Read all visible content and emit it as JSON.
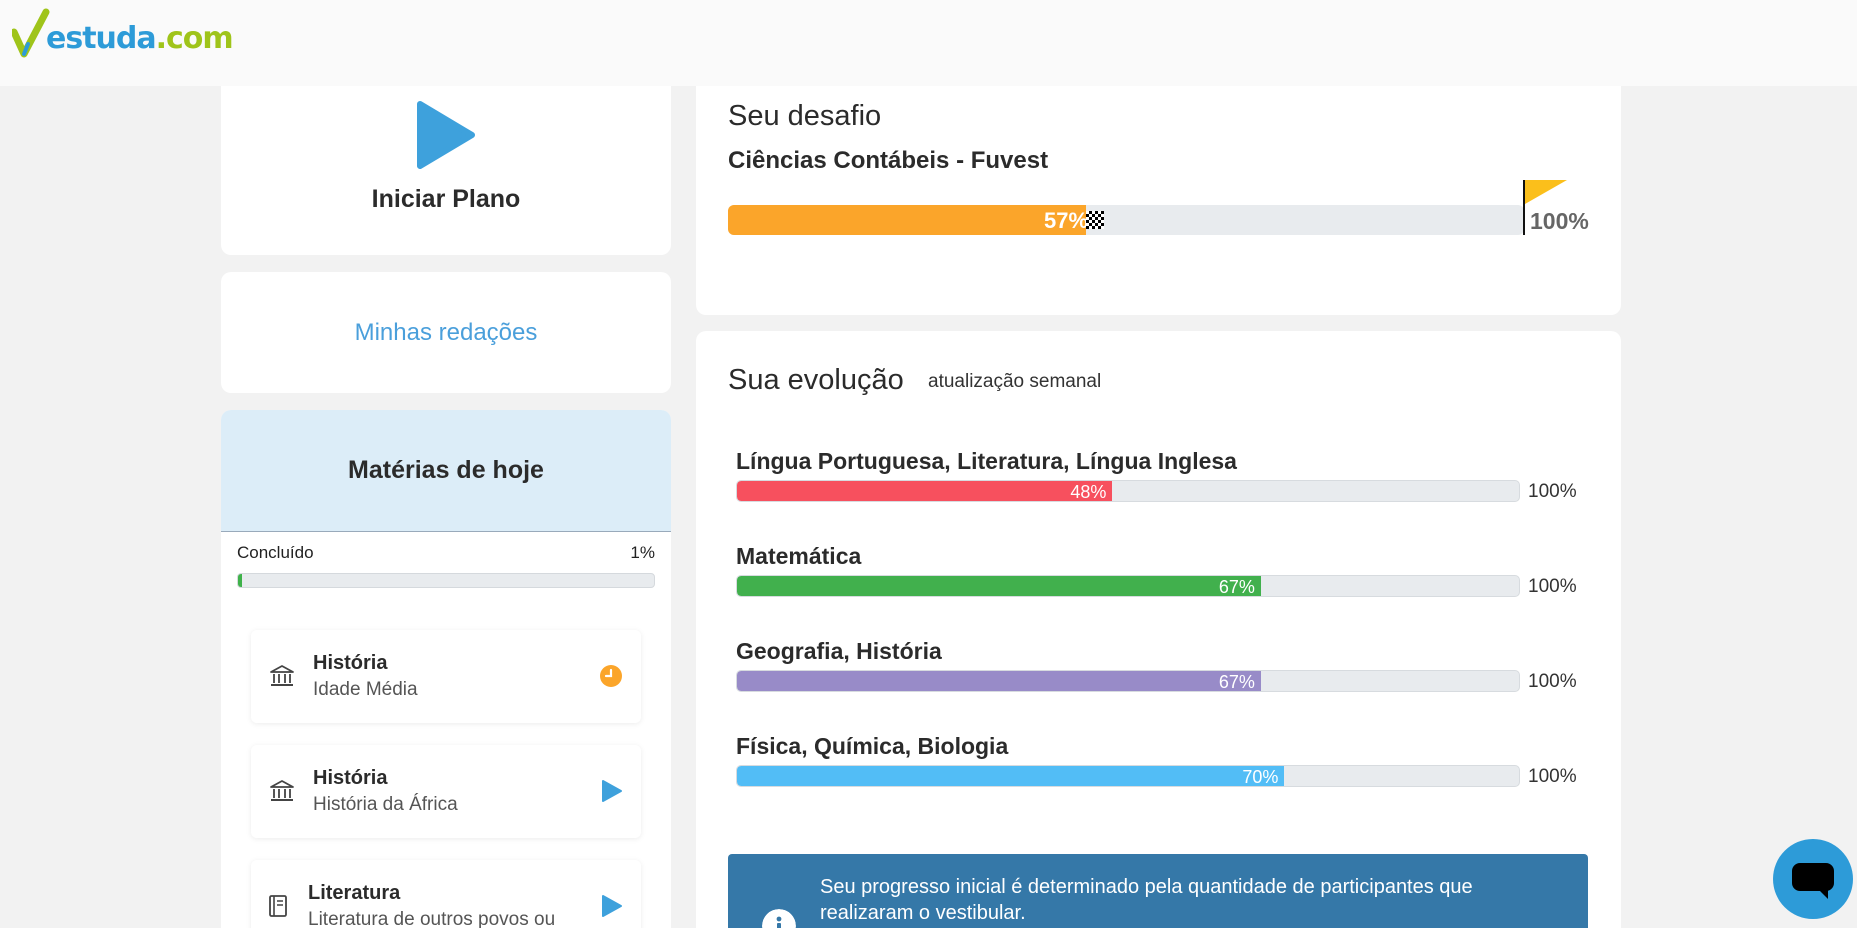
{
  "brand": {
    "logo_part1": "estuda",
    "logo_part2": ".com"
  },
  "plan": {
    "label": "Iniciar Plano"
  },
  "redacoes": {
    "label": "Minhas redações"
  },
  "materias": {
    "title": "Matérias de hoje",
    "concluido_label": "Concluído",
    "concluido_value": "1%",
    "concluido_fraction": 0.01,
    "items": [
      {
        "title": "História",
        "subtitle": "Idade Média",
        "icon": "museum-icon",
        "action": "clock-icon"
      },
      {
        "title": "História",
        "subtitle": "História da África",
        "icon": "museum-icon",
        "action": "play-icon"
      },
      {
        "title": "Literatura",
        "subtitle": "Literatura de outros povos ou",
        "icon": "book-icon",
        "action": "play-icon"
      }
    ]
  },
  "desafio": {
    "title": "Seu desafio",
    "course": "Ciências Contábeis - Fuvest",
    "progress_label": "57%",
    "progress_fraction": 0.45,
    "goal_label": "100%"
  },
  "evolucao": {
    "title": "Sua evolução",
    "subtitle": "atualização semanal",
    "rows": [
      {
        "label": "Língua Portuguesa, Literatura, Língua Inglesa",
        "pct": "48%",
        "fraction": 0.48,
        "color": "#f7505e",
        "goal": "100%"
      },
      {
        "label": "Matemática",
        "pct": "67%",
        "fraction": 0.67,
        "color": "#41b04d",
        "goal": "100%"
      },
      {
        "label": "Geografia, História",
        "pct": "67%",
        "fraction": 0.67,
        "color": "#988bc8",
        "goal": "100%"
      },
      {
        "label": "Física, Química, Biologia",
        "pct": "70%",
        "fraction": 0.7,
        "color": "#52bdf6",
        "goal": "100%"
      }
    ]
  },
  "info": {
    "text": "Seu progresso inicial é determinado pela quantidade de participantes que realizaram o vestibular."
  },
  "colors": {
    "accent": "#2d9bd8",
    "desafio_fill": "#fba52a",
    "goal_flag": "#fbbf1b",
    "info_bg": "#3578a8"
  }
}
